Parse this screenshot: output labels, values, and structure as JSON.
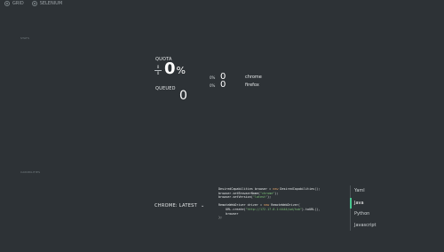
{
  "nav": [
    {
      "label": "GRID"
    },
    {
      "label": "SELENIUM"
    }
  ],
  "sections": {
    "grid_label": "STATS",
    "config_label": "CAPABILITIES"
  },
  "stats": {
    "quota_label": "QUOTA",
    "quota_fraction_top": "0",
    "quota_fraction_bottom": "0",
    "quota_percent": "0",
    "quota_percent_sign": "%",
    "queued_label": "QUEUED",
    "queued_value": "0"
  },
  "browsers": [
    {
      "percent": "0%",
      "count": "0",
      "name": "chrome"
    },
    {
      "percent": "0%",
      "count": "0",
      "name": "firefox"
    }
  ],
  "config": {
    "browser_version": "CHROME: LATEST",
    "chevron": "⌄"
  },
  "code": {
    "l1a": "DesiredCapabilities browser = ",
    "l1b": "new",
    "l1c": " DesiredCapabilities();",
    "l2a": "browser.setBrowserName(",
    "l2b": "\"chrome\"",
    "l2c": ");",
    "l3a": "browser.setVersion(",
    "l3b": "\"latest\"",
    "l3c": ");",
    "l4a": "RemoteWebDriver driver = ",
    "l4b": "new",
    "l4c": " RemoteWebDriver(",
    "l5a": "    URL.create(",
    "l5b": "\"http://172.17.0.1:4444/wd/hub\"",
    "l5c": ").toURL(),",
    "l6": "    browser",
    "l7": ");"
  },
  "languages": [
    {
      "label": "Yaml"
    },
    {
      "label": "Java"
    },
    {
      "label": "Python"
    },
    {
      "label": "Javascript"
    }
  ],
  "colors": {
    "background": "#2d3236",
    "accent": "#48c590",
    "keyword": "#e7a86c",
    "string": "#7fc47a"
  }
}
